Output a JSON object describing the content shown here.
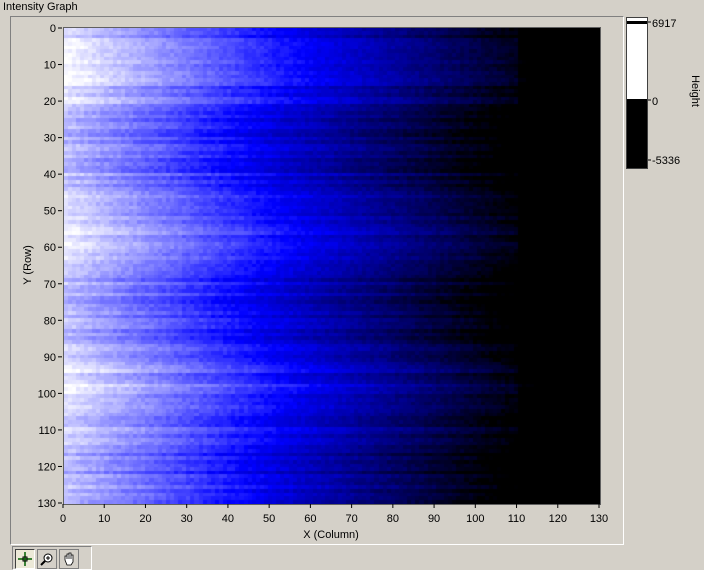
{
  "window": {
    "title": "Intensity Graph"
  },
  "chart_data": {
    "type": "heatmap",
    "xlabel": "X (Column)",
    "ylabel": "Y (Row)",
    "xlim": [
      0,
      130
    ],
    "ylim": [
      0,
      130
    ],
    "x_ticks": [
      "0",
      "10",
      "20",
      "30",
      "40",
      "50",
      "60",
      "70",
      "80",
      "90",
      "100",
      "110",
      "120",
      "130"
    ],
    "y_ticks": [
      "0",
      "10",
      "20",
      "30",
      "40",
      "50",
      "60",
      "70",
      "80",
      "90",
      "100",
      "110",
      "120",
      "130"
    ],
    "colorscale": {
      "label": "Height",
      "max": "6917",
      "mid": "0",
      "min": "-5336",
      "colors": {
        "low": "#000000",
        "mid": "#0000ff",
        "high": "#ffffff"
      }
    }
  },
  "toolbar": {
    "tools": [
      {
        "icon": "cursor-crosshair-icon"
      },
      {
        "icon": "zoom-icon"
      },
      {
        "icon": "pan-hand-icon"
      }
    ]
  }
}
